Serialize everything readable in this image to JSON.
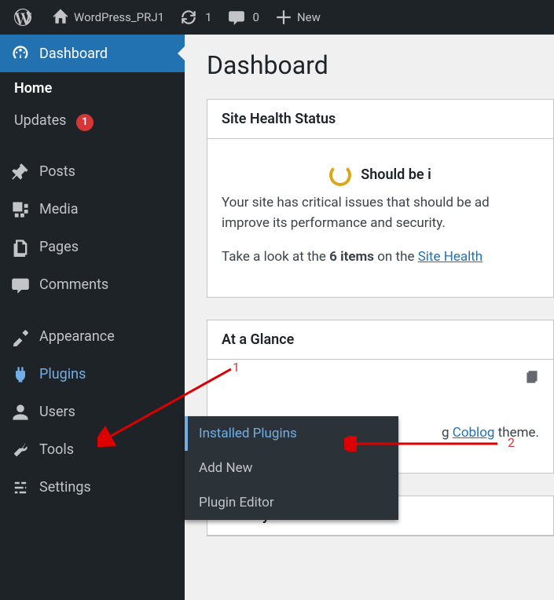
{
  "toolbar": {
    "site_name": "WordPress_PRJ1",
    "updates_count": "1",
    "comments_count": "0",
    "new_label": "New"
  },
  "sidebar": {
    "dashboard": "Dashboard",
    "home": "Home",
    "updates": "Updates",
    "updates_badge": "1",
    "posts": "Posts",
    "media": "Media",
    "pages": "Pages",
    "comments": "Comments",
    "appearance": "Appearance",
    "plugins": "Plugins",
    "users": "Users",
    "tools": "Tools",
    "settings": "Settings"
  },
  "flyout": {
    "installed": "Installed Plugins",
    "add_new": "Add New",
    "editor": "Plugin Editor"
  },
  "main": {
    "heading": "Dashboard",
    "site_health": {
      "title": "Site Health Status",
      "status_label": "Should be i",
      "body_line1": "Your site has critical issues that should be ad",
      "body_line2": "improve its performance and security.",
      "body_line3a": "Take a look at the ",
      "body_line3b": "6 items",
      "body_line3c": " on the ",
      "link": "Site Health "
    },
    "at_a_glance": {
      "title": "At a Glance",
      "theme_pre": "g ",
      "theme_name": "Coblog",
      "theme_post": " theme."
    },
    "activity": {
      "title": "Activity"
    }
  },
  "annotations": {
    "one": "1",
    "two": "2"
  }
}
